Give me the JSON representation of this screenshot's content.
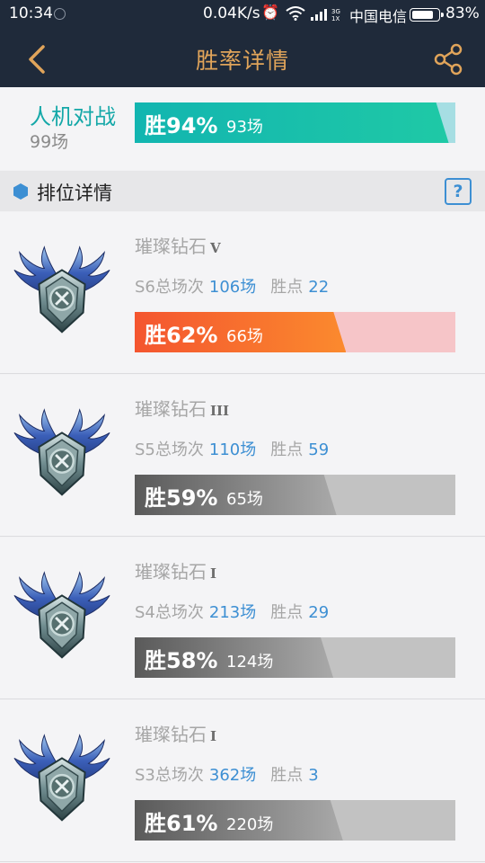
{
  "status_bar": {
    "time": "10:34",
    "speed": "0.04K/s",
    "carrier": "中国电信",
    "battery_percent": 83,
    "battery": "83%"
  },
  "header": {
    "title": "胜率详情",
    "back_icon": "back-chevron-icon",
    "share_icon": "share-icon"
  },
  "pve": {
    "label": "人机对战",
    "count": "99场",
    "win_pct": 94,
    "win_label": "胜94%",
    "wins": "93场",
    "fill_color": "#12b5b0",
    "track_color": "#a6dee3"
  },
  "section": {
    "title": "排位详情",
    "help": "?"
  },
  "ranked": [
    {
      "rank": "璀璨钻石",
      "tier": "V",
      "season_label": "S6总场次",
      "total": "106场",
      "points_label": "胜点",
      "points": "22",
      "win_pct": 62,
      "win_label": "胜62%",
      "wins": "66场",
      "theme": "red"
    },
    {
      "rank": "璀璨钻石",
      "tier": "III",
      "season_label": "S5总场次",
      "total": "110场",
      "points_label": "胜点",
      "points": "59",
      "win_pct": 59,
      "win_label": "胜59%",
      "wins": "65场",
      "theme": "gray"
    },
    {
      "rank": "璀璨钻石",
      "tier": "I",
      "season_label": "S4总场次",
      "total": "213场",
      "points_label": "胜点",
      "points": "29",
      "win_pct": 58,
      "win_label": "胜58%",
      "wins": "124场",
      "theme": "gray"
    },
    {
      "rank": "璀璨钻石",
      "tier": "I",
      "season_label": "S3总场次",
      "total": "362场",
      "points_label": "胜点",
      "points": "3",
      "win_pct": 61,
      "win_label": "胜61%",
      "wins": "220场",
      "theme": "gray"
    }
  ],
  "colors": {
    "header_bg": "#1f2a3a",
    "accent": "#e0a45a",
    "red_fill": "#f4552f",
    "red_track": "#f6c5c8",
    "gray_fill": "#6b6b6b",
    "gray_track": "#c2c2c2",
    "value_blue": "#3d8fd3"
  }
}
